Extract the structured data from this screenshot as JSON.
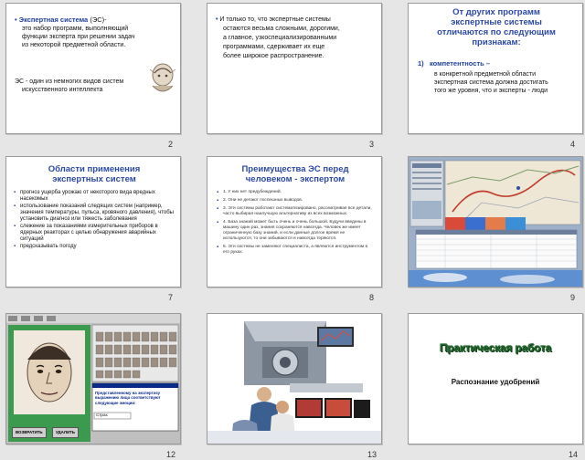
{
  "slides": {
    "s2": {
      "number": "2",
      "title_bold": "Экспертная система",
      "title_rest": " (ЭС)-",
      "line1": "это набор программ, выполняющий",
      "line2": "функции эксперта при решении задач",
      "line3": "из некоторой предметной области.",
      "line4": "ЭС - один из немногих видов систем",
      "line5": "искусственного интеллекта"
    },
    "s3": {
      "number": "3",
      "line1": "И только то, что экспертные системы",
      "line2": "остаются весьма сложными, дорогими,",
      "line3": "а главное, узкоспециализированными",
      "line4": "программами, сдерживает их еще",
      "line5": "более широкое распространение."
    },
    "s4": {
      "number": "4",
      "title1": "От других программ",
      "title2": "экспертные системы",
      "title3": "отличаются по следующим",
      "title4": "признакам:",
      "item_index": "1)",
      "item_label": "компетентность –",
      "body1": "в конкретной предметной области",
      "body2": "экспертная система должна достигать",
      "body3": "того же уровня, что и эксперты - люди"
    },
    "s7": {
      "number": "7",
      "title1": "Области применения",
      "title2": "экспертных систем",
      "items": [
        "прогноз ущерба урожаю от некоторого вида вредных насекомых",
        "использование показаний следящих систем (например, значения температуры, пульса, кровяного давления), чтобы установить диагноз или тяжесть заболевания",
        "слежение за показаниями измерительных приборов в ядерных реакторах с целью обнаружения аварийных ситуаций",
        "предсказывать погоду"
      ]
    },
    "s8": {
      "number": "8",
      "title1": "Преимущества  ЭС перед",
      "title2": "человеком - экспертом",
      "items": [
        "1. У них нет предубеждений.",
        "2. Они не делают поспешных выводов.",
        "3. Эти системы работают систематизировано, рассматривая все детали, часто выбирая наилучшую альтернативу из всех возможных.",
        "4. База знаний может быть очень и очень большой. Будучи введены в машину один раз, знания сохраняются навсегда. Человек же имеет ограниченную базу знаний, и если данные долгое время не используются, то они забываются и навсегда теряются.",
        "5. Эти системы не заменяют специалиста, а являются инструментом в его руках."
      ]
    },
    "s9": {
      "number": "9"
    },
    "s12": {
      "number": "12",
      "prompt": "Представленному на экспертизу выражению лица соответствуют следующие эмоции:",
      "dropdown": "Страх",
      "btn1": "ВОЗВРАТИТЬ",
      "btn2": "УДАЛИТЬ"
    },
    "s13": {
      "number": "13"
    },
    "s14": {
      "number": "14",
      "title": "Практическая  работа",
      "subtitle": "Распознание удобрений"
    }
  }
}
